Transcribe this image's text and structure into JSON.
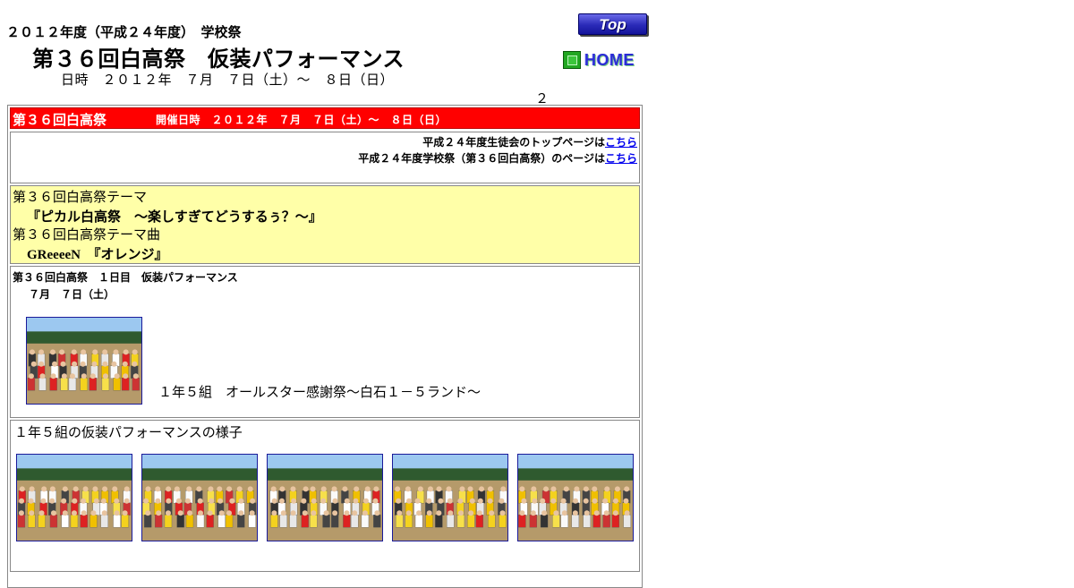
{
  "header": {
    "subtitle": "２０１２年度（平成２４年度）　学校祭",
    "title": "第３６回白高祭　仮装パフォーマンス",
    "dates": "日時　２０１２年　７月　７日（土）～　８日（日）",
    "counter": "２"
  },
  "nav": {
    "top_label": "Top",
    "home_label": "HOME"
  },
  "red_bar": {
    "title": "第３６回白高祭",
    "dates": "開催日時　２０１２年　７月　７日（土）～　８日（日）"
  },
  "links": [
    {
      "text": "平成２４年度生徒会のトップページは",
      "link": "こちら"
    },
    {
      "text": "平成２４年度学校祭（第３６回白高祭）のページは",
      "link": "こちら"
    }
  ],
  "theme": {
    "theme_label": "第３６回白高祭テーマ",
    "theme_value": "『ピカル白高祭　～楽しすぎてどうするぅ？～』",
    "song_label": "第３６回白高祭テーマ曲",
    "song_value": "GReeeeN　『オレンジ』"
  },
  "day1": {
    "title": "第３６回白高祭　１日目　仮装パフォーマンス",
    "date": "７月　７日（土）",
    "caption": "１年５組　オールスター感謝祭～白石１－５ランド～"
  },
  "gallery": {
    "caption": "１年５組の仮装パフォーマンスの様子",
    "photo_count": 5
  },
  "colors": {
    "red_bar": "#ff0000",
    "theme_bg": "#ffffa8",
    "link": "#0000ee"
  }
}
